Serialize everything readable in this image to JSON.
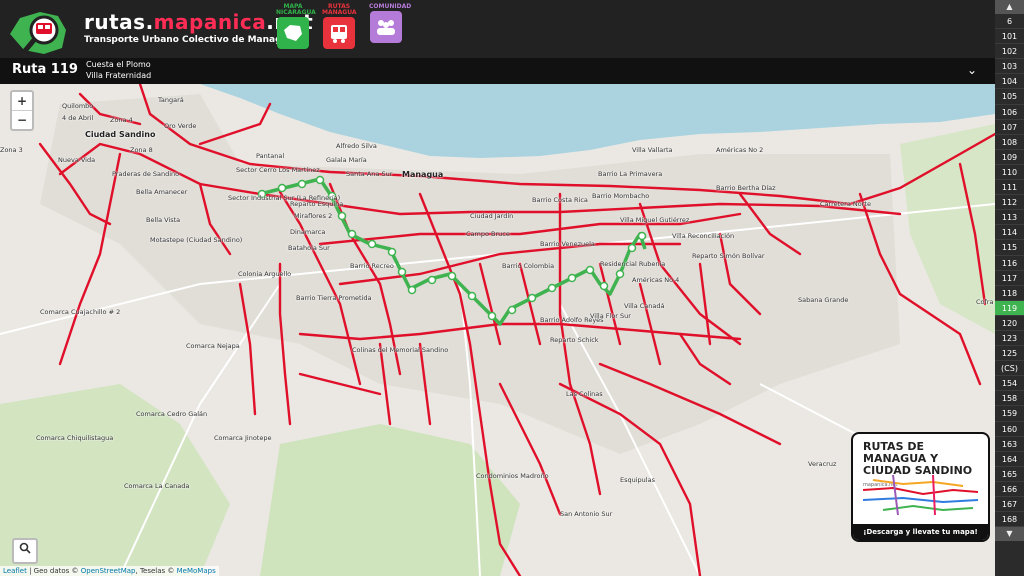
{
  "header": {
    "brand_title_prefix": "rutas.",
    "brand_title_accent": "mapanica",
    "brand_title_suffix": ".net",
    "brand_subtitle": "Transporte Urbano Colectivo de Managua",
    "buttons": [
      {
        "caption": "MAPA NICARAGUA",
        "icon": "nicaragua-map-icon",
        "color": "#2fb34a"
      },
      {
        "caption": "RUTAS MANAGUA",
        "icon": "bus-icon",
        "color": "#e8323c"
      },
      {
        "caption": "COMUNIDAD",
        "icon": "community-icon",
        "color": "#b57bd9"
      }
    ]
  },
  "route": {
    "name": "Ruta 119",
    "stop_from": "Cuesta el Plomo",
    "stop_to": "Villa Fraternidad"
  },
  "map": {
    "zoom_in": "+",
    "zoom_out": "−",
    "attribution_leaflet": "Leaflet",
    "attribution_mid": " | Geo datos © ",
    "attribution_osm": "OpenStreetMap",
    "attribution_tiles": ", Teselas © ",
    "attribution_memomaps": "MeMoMaps",
    "labels": [
      "Tangará",
      "Quilombo",
      "4 de Abril",
      "Zona 4",
      "Ciudad Sandino",
      "Oro Verde",
      "Zona 8",
      "Nueva Vida",
      "Praderas de Sandino",
      "Bella Amanecer",
      "Bella Vista",
      "Pantanal",
      "Alfredo Silva",
      "Sector Cerro Los Martínez",
      "Galala María",
      "Santa Ana Sur",
      "Managua",
      "Villa Vallarta",
      "Américas No 2",
      "Sector Industrial Sur (La Refinería)",
      "Barrio La Primavera",
      "Barrio Bertha Díaz",
      "Reparto Esquina",
      "Miraflores 2",
      "Barrio Costa Rica",
      "Barrio Mombacho",
      "Villa Miguel Gutiérrez",
      "Dinamarca",
      "Ciudad Jardín",
      "Campo Bruce",
      "Villa Reconciliación",
      "Batahola Sur",
      "Motastepe (Ciudad Sandino)",
      "Barrio Venezuela",
      "Residencial Rubenia",
      "Reparto Simón Bolívar",
      "Barrio Recreo",
      "Barrio Colombia",
      "Américas No 4",
      "Colonia Arguello",
      "Barrio Tierra Prometida",
      "Sabana Grande",
      "Comarca Cuajachillo # 2",
      "Barrio Adolfo Reyes",
      "Villa Flor Sur",
      "Villa Canadá",
      "Reparto Schick",
      "Colinas del Memorial Sandino",
      "Comarca Nejapa",
      "Las Colinas",
      "Comarca Cedro Galán",
      "Comarca Jinotepe",
      "Comarca Chiquilistagua",
      "Condominios Madroño",
      "Veracruz",
      "Comarca La Canada",
      "Esquipulas",
      "San Antonio Sur",
      "Carretera Norte",
      "Zona 3",
      "Cofra"
    ]
  },
  "promo": {
    "title_line1": "RUTAS DE MANAGUA Y",
    "title_line2": "CIUDAD SANDINO",
    "site": "mapanica.net",
    "cta": "¡Descarga y llevate tu mapa!"
  },
  "sidebar": {
    "active": "119",
    "routes": [
      "6",
      "101",
      "102",
      "103",
      "104",
      "105",
      "106",
      "107",
      "108",
      "109",
      "110",
      "111",
      "112",
      "113",
      "114",
      "115",
      "116",
      "117",
      "118",
      "119",
      "120",
      "123",
      "125",
      "(CS)",
      "154",
      "158",
      "159",
      "160",
      "163",
      "164",
      "165",
      "166",
      "167",
      "168"
    ]
  },
  "colors": {
    "route_network": "#e0102a",
    "selected_route": "#3fb34f",
    "water": "#aad3df",
    "park": "#c8e2b3"
  }
}
